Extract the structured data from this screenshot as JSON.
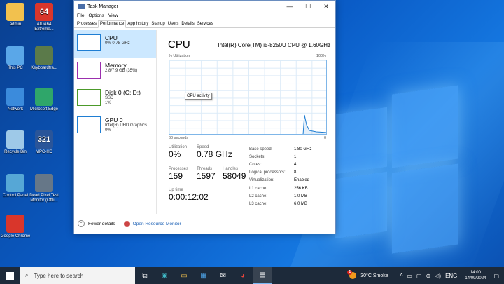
{
  "desktop": {
    "icons": [
      {
        "label": "admin",
        "badge": "",
        "color": "#f2c14e"
      },
      {
        "label": "AIDA64 Extreme...",
        "badge": "64",
        "color": "#d9362b"
      },
      {
        "label": "This PC",
        "badge": "",
        "color": "#5aa7e8"
      },
      {
        "label": "Keyboardtra...",
        "badge": "",
        "color": "#5b7a4a"
      },
      {
        "label": "Network",
        "badge": "",
        "color": "#3b8bdc"
      },
      {
        "label": "Microsoft Edge",
        "badge": "",
        "color": "#2fa66a"
      },
      {
        "label": "Recycle Bin",
        "badge": "",
        "color": "#9ec9e8"
      },
      {
        "label": "MPC-HC",
        "badge": "321",
        "color": "#2a5599"
      },
      {
        "label": "Control Panel",
        "badge": "",
        "color": "#56a7d6"
      },
      {
        "label": "Dead Pixel Test Monitor (Offli...",
        "badge": "",
        "color": "#667788"
      },
      {
        "label": "Google Chrome",
        "badge": "",
        "color": "#d9362b"
      }
    ]
  },
  "taskmanager": {
    "title": "Task Manager",
    "menu": [
      "File",
      "Options",
      "View"
    ],
    "tabs": [
      "Processes",
      "Performance",
      "App history",
      "Startup",
      "Users",
      "Details",
      "Services"
    ],
    "active_tab": "Performance",
    "resources": [
      {
        "name": "CPU",
        "sub1": "0%  0.78 GHz",
        "sub2": "",
        "sub3": "",
        "color": "#1f7ed3"
      },
      {
        "name": "Memory",
        "sub1": "2.8/7.9 GB (35%)",
        "sub2": "",
        "sub3": "",
        "color": "#9b2fae"
      },
      {
        "name": "Disk 0 (C: D:)",
        "sub1": "SSD",
        "sub2": "1%",
        "sub3": "",
        "color": "#4c9a2a"
      },
      {
        "name": "GPU 0",
        "sub1": "Intel(R) UHD Graphics ...",
        "sub2": "0%",
        "sub3": "",
        "color": "#1f7ed3"
      }
    ],
    "cpu": {
      "title": "CPU",
      "model": "Intel(R) Core(TM) i5-8250U CPU @ 1.60GHz",
      "util_label": "% Utilization",
      "util_max": "100%",
      "tooltip": "CPU activity",
      "time_left": "60 seconds",
      "time_right": "0",
      "utilization_label": "Utilization",
      "utilization": "0%",
      "speed_label": "Speed",
      "speed": "0.78 GHz",
      "processes_label": "Processes",
      "processes": "159",
      "threads_label": "Threads",
      "threads": "1597",
      "handles_label": "Handles",
      "handles": "58049",
      "uptime_label": "Up time",
      "uptime": "0:00:12:02",
      "details": [
        {
          "k": "Base speed:",
          "v": "1.80 GHz"
        },
        {
          "k": "Sockets:",
          "v": "1"
        },
        {
          "k": "Cores:",
          "v": "4"
        },
        {
          "k": "Logical processors:",
          "v": "8"
        },
        {
          "k": "Virtualization:",
          "v": "Enabled"
        },
        {
          "k": "L1 cache:",
          "v": "256 KB"
        },
        {
          "k": "L2 cache:",
          "v": "1.0 MB"
        },
        {
          "k": "L3 cache:",
          "v": "6.0 MB"
        }
      ]
    },
    "footer": {
      "fewer_details": "Fewer details",
      "open_monitor": "Open Resource Monitor"
    }
  },
  "taskbar": {
    "search_placeholder": "Type here to search",
    "weather": "30°C  Smoke",
    "weather_badge": "1",
    "lang": "ENG",
    "time": "14:00",
    "date": "14/09/2024"
  }
}
